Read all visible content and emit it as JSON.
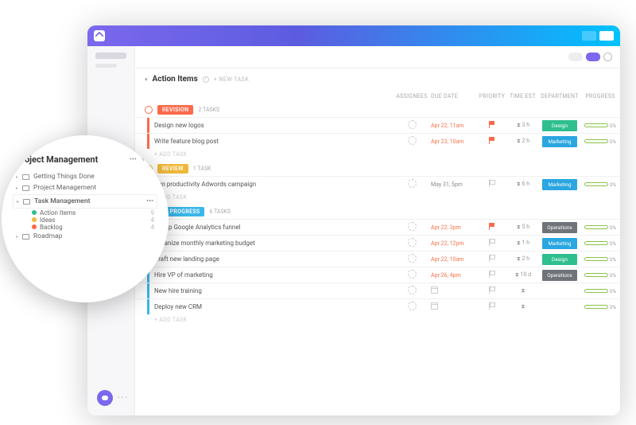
{
  "section": {
    "title": "Action Items",
    "new_task": "+ NEW TASK",
    "add_task": "+ ADD TASK"
  },
  "cols": {
    "assignees": "ASSIGNEES",
    "due": "DUE DATE",
    "priority": "PRIORITY",
    "time": "TIME EST.",
    "dept": "DEPARTMENT",
    "prog": "PROGRESS"
  },
  "groups": [
    {
      "label": "REVISION",
      "count": "2 TASKS",
      "color": "#fd6a4b",
      "tasks": [
        {
          "title": "Design new logos",
          "due": "Apr 22, 11am",
          "pri": "#fd6a4b",
          "time": "3 h",
          "dept": "Design",
          "deptColor": "#2fbf8f",
          "prog": "0%"
        },
        {
          "title": "Write feature blog post",
          "due": "Apr 23, 10am",
          "pri": "#fd6a4b",
          "time": "2 h",
          "dept": "Marketing",
          "deptColor": "#2aa6e0",
          "prog": "0%"
        }
      ]
    },
    {
      "label": "REVIEW",
      "count": "1 TASK",
      "color": "#f0b83a",
      "tasks": [
        {
          "title": "Run productivity Adwords campaign",
          "due": "May 31, 5pm",
          "dueGray": true,
          "pri": "outline",
          "time": "6 h",
          "dept": "Marketing",
          "deptColor": "#2aa6e0",
          "prog": "0%"
        }
      ]
    },
    {
      "label": "IN PROGRESS",
      "count": "6 TASKS",
      "color": "#3bb6ea",
      "tasks": [
        {
          "title": "Set up Google Analytics funnel",
          "due": "Apr 22, 3pm",
          "pri": "#fd6a4b",
          "time": "5 h",
          "dept": "Operations",
          "deptColor": "#6f737a",
          "prog": "0%"
        },
        {
          "title": "Organize monthly marketing budget",
          "due": "Apr 22, 12pm",
          "pri": "outline",
          "time": "1 h",
          "dept": "Marketing",
          "deptColor": "#2aa6e0",
          "prog": "0%"
        },
        {
          "title": "Draft new landing page",
          "due": "Apr 22, 10am",
          "pri": "outline",
          "time": "2 h",
          "dept": "Design",
          "deptColor": "#2fbf8f",
          "prog": "0%"
        },
        {
          "title": "Hire VP of marketing",
          "due": "Apr 26, 4pm",
          "pri": "outline",
          "time": "10 d",
          "dept": "Operations",
          "deptColor": "#6f737a",
          "prog": "0%"
        },
        {
          "title": "New hire training",
          "due": "",
          "pri": "outline",
          "time": "",
          "dept": "",
          "prog": "0%"
        },
        {
          "title": "Deploy new CRM",
          "due": "",
          "pri": "outline",
          "time": "",
          "dept": "",
          "prog": "0%"
        }
      ]
    }
  ],
  "bubble": {
    "title": "Project Management",
    "items": [
      {
        "label": "Getting Things Done"
      },
      {
        "label": "Project Management"
      },
      {
        "label": "Task Management",
        "selected": true
      },
      {
        "label": "Roadmap"
      }
    ],
    "subs": [
      {
        "label": "Action Items",
        "count": "9",
        "color": "#2fbf8f"
      },
      {
        "label": "Ideas",
        "count": "4",
        "color": "#f0b83a"
      },
      {
        "label": "Backlog",
        "count": "4",
        "color": "#fd6a4b"
      }
    ]
  }
}
